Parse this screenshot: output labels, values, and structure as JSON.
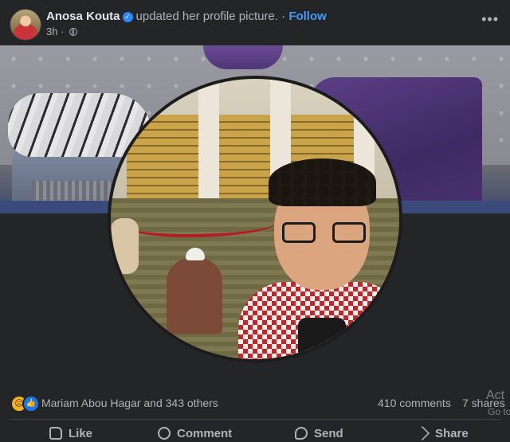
{
  "post": {
    "author": "Anosa Kouta",
    "action": "updated her profile picture.",
    "separator": "·",
    "follow_label": "Follow",
    "time": "3h",
    "more_label": "•••"
  },
  "stats": {
    "reactors": "Mariam Abou Hagar and 343 others",
    "comments": "410 comments",
    "shares": "7 shares"
  },
  "overlay": {
    "activate": "Act",
    "go_to": "Go to"
  },
  "actions": {
    "like": "Like",
    "comment": "Comment",
    "send": "Send",
    "share": "Share"
  },
  "icons": {
    "verified": "verified-badge-icon",
    "audience": "globe-icon",
    "reaction_sad": "sad-reaction-icon",
    "reaction_like": "like-reaction-icon"
  },
  "colors": {
    "background": "#242526",
    "text": "#e4e6eb",
    "muted": "#b0b3b8",
    "link": "#4599ff"
  }
}
